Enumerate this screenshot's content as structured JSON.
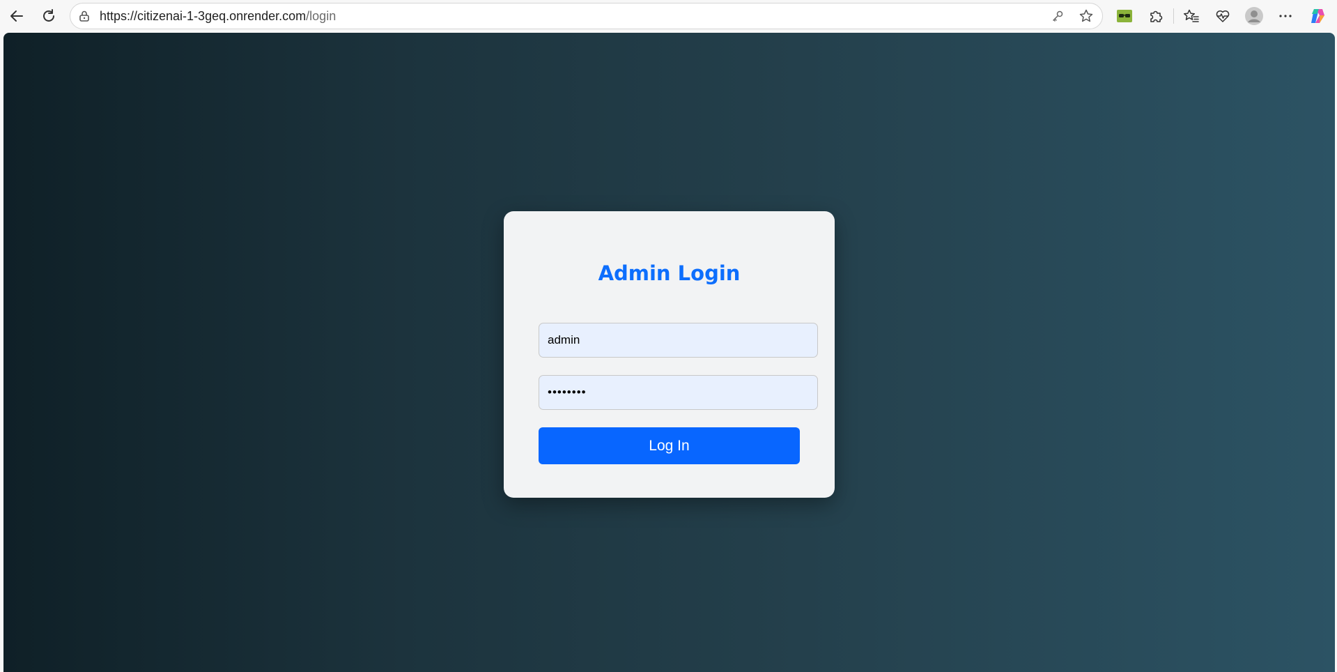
{
  "browser": {
    "url_host": "https://citizenai-1-3geq.onrender.com",
    "url_path": "/login",
    "icons": {
      "back": "back-arrow-icon",
      "reload": "reload-icon",
      "lock": "site-info-lock-icon",
      "key": "password-key-icon",
      "favorite": "star-icon",
      "extension_1": "glasses-extension-icon",
      "extensions": "puzzle-icon",
      "favorites": "favorites-icon",
      "health": "browser-essentials-icon",
      "profile": "profile-avatar-icon",
      "more": "more-options-icon",
      "copilot": "copilot-icon"
    }
  },
  "login": {
    "title": "Admin Login",
    "username_value": "admin",
    "password_value": "••••••••",
    "button_label": "Log In"
  },
  "colors": {
    "accent": "#0d6efd",
    "button": "#0866ff",
    "input_bg": "#e8f0fe",
    "card_bg": "#f2f3f4",
    "gradient_start": "#0f2027",
    "gradient_end": "#2c5364"
  }
}
